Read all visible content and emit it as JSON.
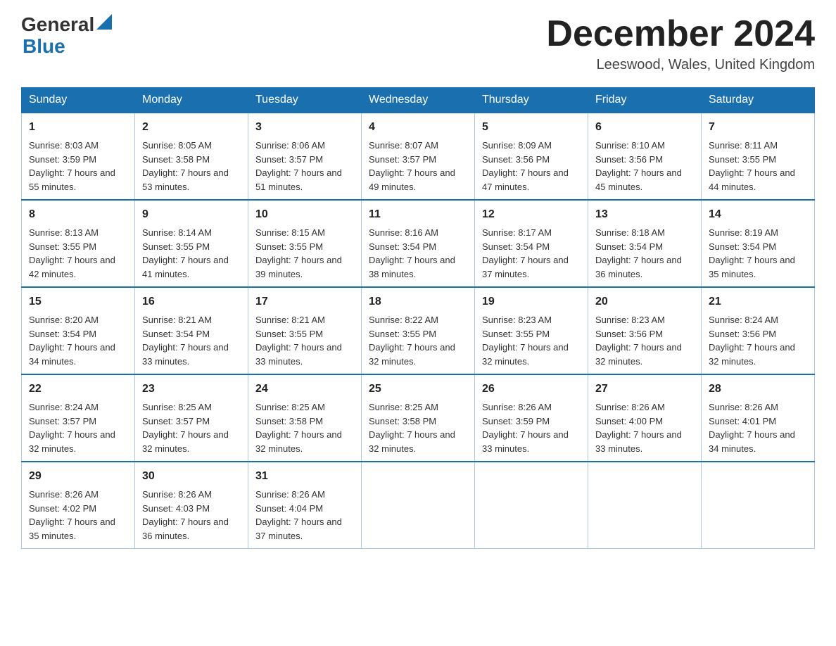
{
  "header": {
    "logo_general": "General",
    "logo_blue": "Blue",
    "month_title": "December 2024",
    "location": "Leeswood, Wales, United Kingdom"
  },
  "days_of_week": [
    "Sunday",
    "Monday",
    "Tuesday",
    "Wednesday",
    "Thursday",
    "Friday",
    "Saturday"
  ],
  "weeks": [
    [
      {
        "day": "1",
        "sunrise": "Sunrise: 8:03 AM",
        "sunset": "Sunset: 3:59 PM",
        "daylight": "Daylight: 7 hours and 55 minutes."
      },
      {
        "day": "2",
        "sunrise": "Sunrise: 8:05 AM",
        "sunset": "Sunset: 3:58 PM",
        "daylight": "Daylight: 7 hours and 53 minutes."
      },
      {
        "day": "3",
        "sunrise": "Sunrise: 8:06 AM",
        "sunset": "Sunset: 3:57 PM",
        "daylight": "Daylight: 7 hours and 51 minutes."
      },
      {
        "day": "4",
        "sunrise": "Sunrise: 8:07 AM",
        "sunset": "Sunset: 3:57 PM",
        "daylight": "Daylight: 7 hours and 49 minutes."
      },
      {
        "day": "5",
        "sunrise": "Sunrise: 8:09 AM",
        "sunset": "Sunset: 3:56 PM",
        "daylight": "Daylight: 7 hours and 47 minutes."
      },
      {
        "day": "6",
        "sunrise": "Sunrise: 8:10 AM",
        "sunset": "Sunset: 3:56 PM",
        "daylight": "Daylight: 7 hours and 45 minutes."
      },
      {
        "day": "7",
        "sunrise": "Sunrise: 8:11 AM",
        "sunset": "Sunset: 3:55 PM",
        "daylight": "Daylight: 7 hours and 44 minutes."
      }
    ],
    [
      {
        "day": "8",
        "sunrise": "Sunrise: 8:13 AM",
        "sunset": "Sunset: 3:55 PM",
        "daylight": "Daylight: 7 hours and 42 minutes."
      },
      {
        "day": "9",
        "sunrise": "Sunrise: 8:14 AM",
        "sunset": "Sunset: 3:55 PM",
        "daylight": "Daylight: 7 hours and 41 minutes."
      },
      {
        "day": "10",
        "sunrise": "Sunrise: 8:15 AM",
        "sunset": "Sunset: 3:55 PM",
        "daylight": "Daylight: 7 hours and 39 minutes."
      },
      {
        "day": "11",
        "sunrise": "Sunrise: 8:16 AM",
        "sunset": "Sunset: 3:54 PM",
        "daylight": "Daylight: 7 hours and 38 minutes."
      },
      {
        "day": "12",
        "sunrise": "Sunrise: 8:17 AM",
        "sunset": "Sunset: 3:54 PM",
        "daylight": "Daylight: 7 hours and 37 minutes."
      },
      {
        "day": "13",
        "sunrise": "Sunrise: 8:18 AM",
        "sunset": "Sunset: 3:54 PM",
        "daylight": "Daylight: 7 hours and 36 minutes."
      },
      {
        "day": "14",
        "sunrise": "Sunrise: 8:19 AM",
        "sunset": "Sunset: 3:54 PM",
        "daylight": "Daylight: 7 hours and 35 minutes."
      }
    ],
    [
      {
        "day": "15",
        "sunrise": "Sunrise: 8:20 AM",
        "sunset": "Sunset: 3:54 PM",
        "daylight": "Daylight: 7 hours and 34 minutes."
      },
      {
        "day": "16",
        "sunrise": "Sunrise: 8:21 AM",
        "sunset": "Sunset: 3:54 PM",
        "daylight": "Daylight: 7 hours and 33 minutes."
      },
      {
        "day": "17",
        "sunrise": "Sunrise: 8:21 AM",
        "sunset": "Sunset: 3:55 PM",
        "daylight": "Daylight: 7 hours and 33 minutes."
      },
      {
        "day": "18",
        "sunrise": "Sunrise: 8:22 AM",
        "sunset": "Sunset: 3:55 PM",
        "daylight": "Daylight: 7 hours and 32 minutes."
      },
      {
        "day": "19",
        "sunrise": "Sunrise: 8:23 AM",
        "sunset": "Sunset: 3:55 PM",
        "daylight": "Daylight: 7 hours and 32 minutes."
      },
      {
        "day": "20",
        "sunrise": "Sunrise: 8:23 AM",
        "sunset": "Sunset: 3:56 PM",
        "daylight": "Daylight: 7 hours and 32 minutes."
      },
      {
        "day": "21",
        "sunrise": "Sunrise: 8:24 AM",
        "sunset": "Sunset: 3:56 PM",
        "daylight": "Daylight: 7 hours and 32 minutes."
      }
    ],
    [
      {
        "day": "22",
        "sunrise": "Sunrise: 8:24 AM",
        "sunset": "Sunset: 3:57 PM",
        "daylight": "Daylight: 7 hours and 32 minutes."
      },
      {
        "day": "23",
        "sunrise": "Sunrise: 8:25 AM",
        "sunset": "Sunset: 3:57 PM",
        "daylight": "Daylight: 7 hours and 32 minutes."
      },
      {
        "day": "24",
        "sunrise": "Sunrise: 8:25 AM",
        "sunset": "Sunset: 3:58 PM",
        "daylight": "Daylight: 7 hours and 32 minutes."
      },
      {
        "day": "25",
        "sunrise": "Sunrise: 8:25 AM",
        "sunset": "Sunset: 3:58 PM",
        "daylight": "Daylight: 7 hours and 32 minutes."
      },
      {
        "day": "26",
        "sunrise": "Sunrise: 8:26 AM",
        "sunset": "Sunset: 3:59 PM",
        "daylight": "Daylight: 7 hours and 33 minutes."
      },
      {
        "day": "27",
        "sunrise": "Sunrise: 8:26 AM",
        "sunset": "Sunset: 4:00 PM",
        "daylight": "Daylight: 7 hours and 33 minutes."
      },
      {
        "day": "28",
        "sunrise": "Sunrise: 8:26 AM",
        "sunset": "Sunset: 4:01 PM",
        "daylight": "Daylight: 7 hours and 34 minutes."
      }
    ],
    [
      {
        "day": "29",
        "sunrise": "Sunrise: 8:26 AM",
        "sunset": "Sunset: 4:02 PM",
        "daylight": "Daylight: 7 hours and 35 minutes."
      },
      {
        "day": "30",
        "sunrise": "Sunrise: 8:26 AM",
        "sunset": "Sunset: 4:03 PM",
        "daylight": "Daylight: 7 hours and 36 minutes."
      },
      {
        "day": "31",
        "sunrise": "Sunrise: 8:26 AM",
        "sunset": "Sunset: 4:04 PM",
        "daylight": "Daylight: 7 hours and 37 minutes."
      },
      null,
      null,
      null,
      null
    ]
  ]
}
